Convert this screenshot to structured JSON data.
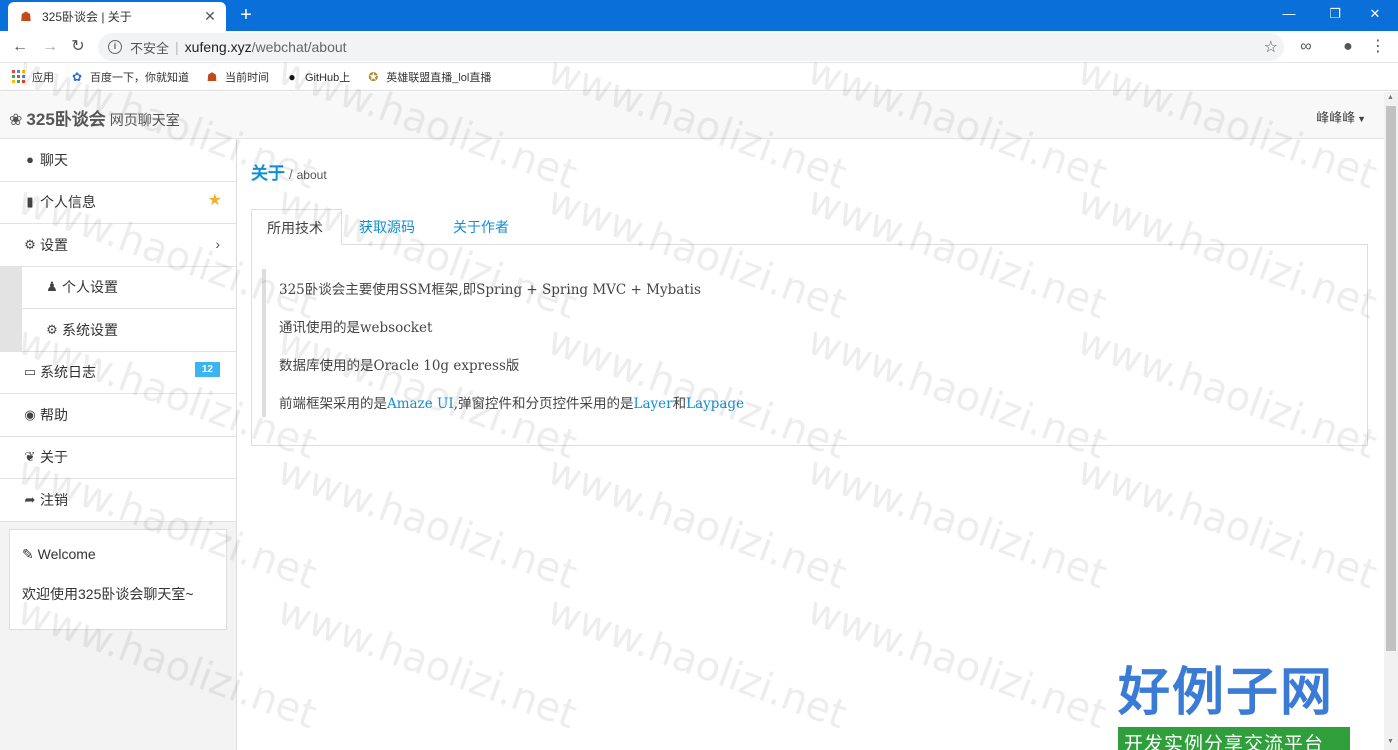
{
  "browser": {
    "tab_title": "325卧谈会 | 关于",
    "insecure_label": "不安全",
    "url_host": "xufeng.xyz",
    "url_path": "/webchat/about"
  },
  "bookmarks": [
    {
      "label": "应用",
      "icon": "apps-icon"
    },
    {
      "label": "百度一下，你就知道",
      "icon": "baidu-paw-icon"
    },
    {
      "label": "当前时间",
      "icon": "clock-favicon"
    },
    {
      "label": "GitHub上",
      "icon": "github-icon"
    },
    {
      "label": "英雄联盟直播_lol直播",
      "icon": "lol-icon"
    }
  ],
  "app": {
    "brand_name": "325卧谈会",
    "brand_sub": "网页聊天室",
    "user_name": "峰峰峰"
  },
  "sidebar": {
    "items": [
      {
        "label": "聊天",
        "icon": "comment-icon"
      },
      {
        "label": "个人信息",
        "icon": "book-icon"
      },
      {
        "label": "设置",
        "icon": "cogs-icon"
      },
      {
        "label": "个人设置",
        "icon": "users-icon"
      },
      {
        "label": "系统设置",
        "icon": "gear-icon"
      },
      {
        "label": "系统日志",
        "icon": "inbox-icon",
        "badge": "12"
      },
      {
        "label": "帮助",
        "icon": "globe-icon"
      },
      {
        "label": "关于",
        "icon": "leaf-icon"
      },
      {
        "label": "注销",
        "icon": "sign-out-icon"
      }
    ]
  },
  "welcome": {
    "title": "Welcome",
    "text": "欢迎使用325卧谈会聊天室~"
  },
  "main": {
    "crumb_title": "关于",
    "crumb_sep": "/",
    "crumb_sub": "about",
    "tabs": [
      {
        "label": "所用技术",
        "active": true
      },
      {
        "label": "获取源码",
        "active": false
      },
      {
        "label": "关于作者",
        "active": false
      }
    ],
    "lines": {
      "l1": "325卧谈会主要使用SSM框架,即Spring + Spring MVC + Mybatis",
      "l2": "通讯使用的是websocket",
      "l3": "数据库使用的是Oracle 10g express版",
      "l4_prefix": "前端框架采用的是",
      "l4_link1": "Amaze UI",
      "l4_mid": ",弹窗控件和分页控件采用的是",
      "l4_link2": "Layer",
      "l4_and": "和",
      "l4_link3": "Laypage"
    }
  },
  "watermark": {
    "text": "www.haolizi.net",
    "logo_main": "好例子网",
    "logo_sub": "开发实例分享交流平台"
  },
  "colors": {
    "accent": "#0e90d2",
    "chrome_blue": "#0a6fd8",
    "badge_blue": "#3bb4f2",
    "star_yellow": "#f1b12c"
  }
}
